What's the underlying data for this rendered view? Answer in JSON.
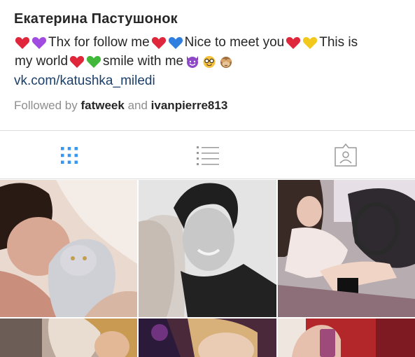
{
  "profile": {
    "name": "Екатерина Пастушонок",
    "bio": {
      "t1": "Thx for follow me",
      "t2": "Nice to meet you",
      "t3": "This is",
      "t4": "my world",
      "t5": "smile with me"
    },
    "link": "vk.com/katushka_miledi",
    "followed_prefix": "Followed by",
    "followed_user1": "fatweek",
    "followed_and": "and",
    "followed_user2": "ivanpierre813"
  },
  "tabs": [
    {
      "icon": "grid-icon",
      "active": true
    },
    {
      "icon": "list-icon",
      "active": false
    },
    {
      "icon": "tagged-person-icon",
      "active": false
    }
  ],
  "colors": {
    "accent": "#3897f0",
    "inactive_icon": "#999999",
    "link": "#1a3f6b",
    "muted": "#8e8e8e"
  },
  "posts": [
    {
      "subject": "boy-with-cat"
    },
    {
      "subject": "couple-selfie"
    },
    {
      "subject": "girl-driving-car"
    },
    {
      "subject": "girl-in-car"
    },
    {
      "subject": "girl-night-portrait"
    },
    {
      "subject": "hand-with-phone"
    }
  ]
}
